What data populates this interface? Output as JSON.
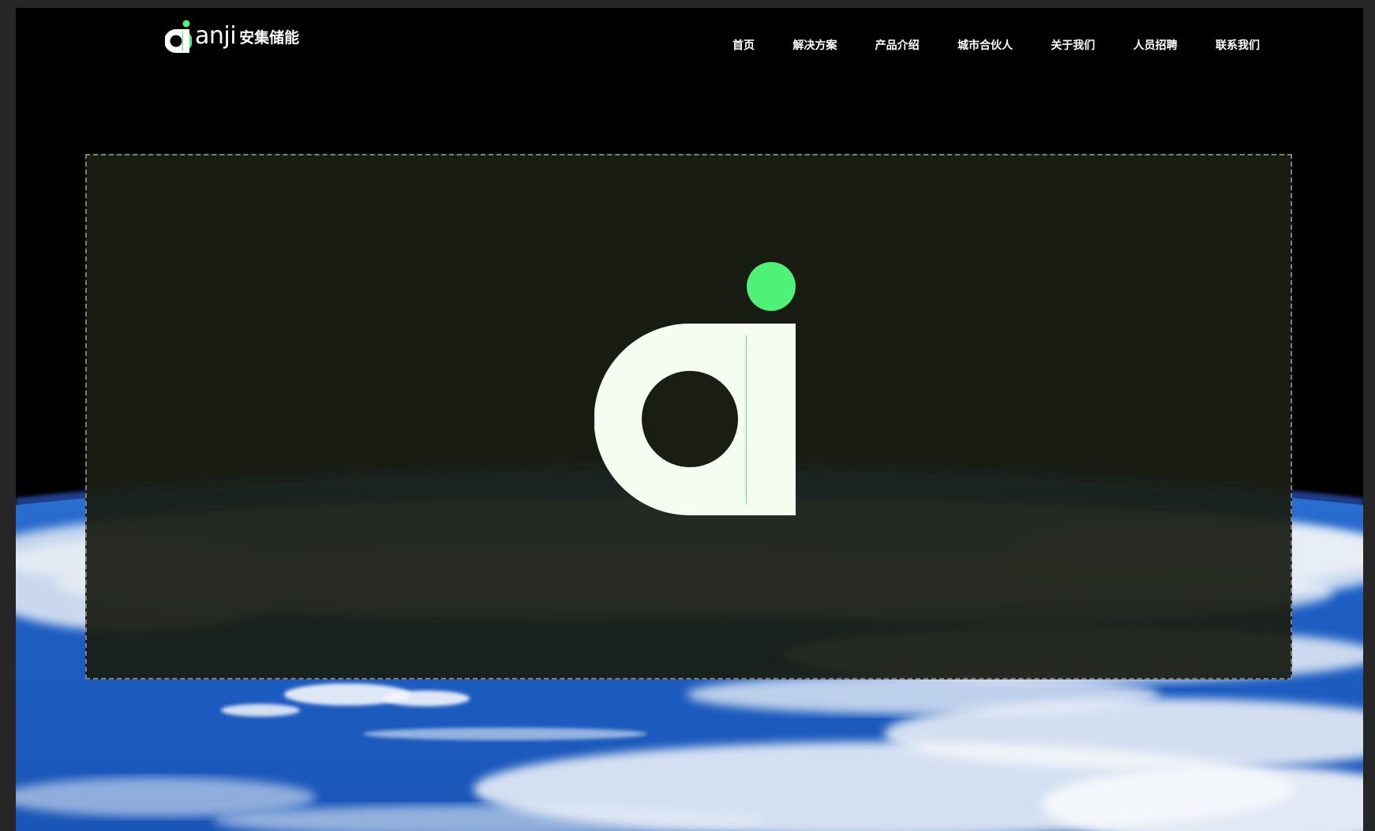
{
  "brand": {
    "wordmark": "anji",
    "name_cn": "安集储能"
  },
  "nav": {
    "items": [
      {
        "label": "首页"
      },
      {
        "label": "解决方案"
      },
      {
        "label": "产品介绍"
      },
      {
        "label": "城市合伙人"
      },
      {
        "label": "关于我们"
      },
      {
        "label": "人员招聘"
      },
      {
        "label": "联系我们"
      }
    ]
  },
  "hero": {
    "background": "earth-from-space-image",
    "logo_icon": "anji-ai-logo-icon"
  },
  "colors": {
    "accent_green": "#4ef277",
    "logo_white": "#f5fdf0",
    "page_bg": "#000000",
    "frame_tint": "#1a1e14",
    "nav_text": "#ffffff"
  }
}
